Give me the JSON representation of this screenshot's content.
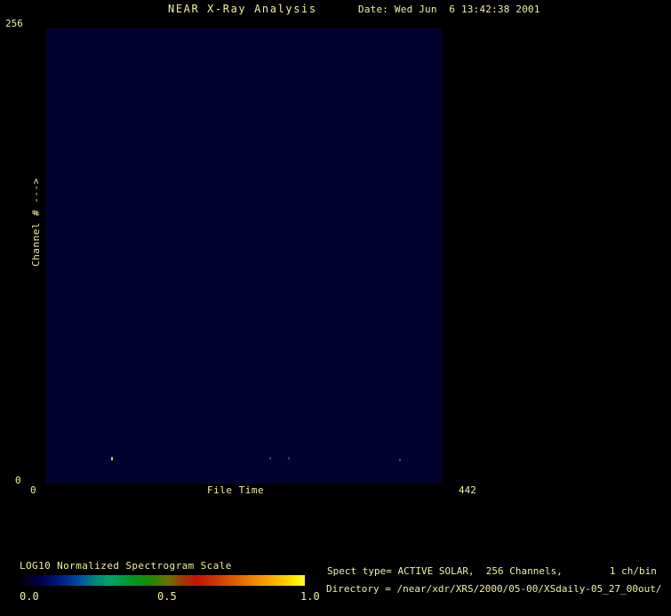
{
  "header": {
    "title": "NEAR X-Ray Analysis",
    "date_label": "Date: Wed Jun  6 13:42:38 2001"
  },
  "plot": {
    "y_axis": {
      "label": "Channel # --->",
      "max_tick": "256",
      "min_tick": "0"
    },
    "x_axis": {
      "label": "File Time",
      "min_tick": "0",
      "max_tick": "442"
    }
  },
  "colorbar": {
    "title": "LOG10 Normalized Spectrogram Scale",
    "tick_labels": [
      "0.0",
      "0.5",
      "1.0"
    ],
    "gradient_stops": [
      {
        "pos": 0,
        "color": "#000004"
      },
      {
        "pos": 7,
        "color": "#000048"
      },
      {
        "pos": 14,
        "color": "#001880"
      },
      {
        "pos": 21,
        "color": "#0050a0"
      },
      {
        "pos": 27,
        "color": "#008a80"
      },
      {
        "pos": 32,
        "color": "#00a45e"
      },
      {
        "pos": 40,
        "color": "#009420"
      },
      {
        "pos": 46,
        "color": "#1e8600"
      },
      {
        "pos": 52,
        "color": "#6d7000"
      },
      {
        "pos": 57,
        "color": "#9c3a00"
      },
      {
        "pos": 62,
        "color": "#c41400"
      },
      {
        "pos": 68,
        "color": "#cc3300"
      },
      {
        "pos": 76,
        "color": "#e06000"
      },
      {
        "pos": 84,
        "color": "#f59200"
      },
      {
        "pos": 91,
        "color": "#ffbe00"
      },
      {
        "pos": 97,
        "color": "#ffec00"
      },
      {
        "pos": 100,
        "color": "#fff83c"
      }
    ]
  },
  "footer": {
    "spect_info": "Spect type= ACTIVE SOLAR,  256 Channels,        1 ch/bin",
    "directory": "Directory = /near/xdr/XRS/2000/05-00/XSdaily-05_27_00out/"
  },
  "colors": {
    "background": "#000000",
    "text": "#f2efa3",
    "plot_background": "#02022e"
  },
  "chart_data": {
    "type": "heatmap",
    "title": "NEAR X-Ray Analysis",
    "xlabel": "File Time",
    "ylabel": "Channel #",
    "xlim": [
      0,
      442
    ],
    "ylim": [
      0,
      256
    ],
    "colorbar_label": "LOG10 Normalized Spectrogram Scale",
    "colorbar_ticks": [
      0.0,
      0.5,
      1.0
    ],
    "background_value_color": "#02022e",
    "note": "Spectrogram is almost entirely at the minimum (dark navy) level; only a few faint low-channel points are visible near the bottom of the plot.",
    "points": [
      {
        "file_time": 72,
        "channel": 14,
        "value": 0.85,
        "color": "#c9c23e",
        "px": {
          "x": 73,
          "y": 482,
          "w": 2,
          "h": 4
        }
      },
      {
        "file_time": 249,
        "channel": 14,
        "value": 0.12,
        "color": "#2b3c69",
        "px": {
          "x": 251,
          "y": 482,
          "w": 2,
          "h": 3
        }
      },
      {
        "file_time": 270,
        "channel": 14,
        "value": 0.12,
        "color": "#2b3c69",
        "px": {
          "x": 272,
          "y": 482,
          "w": 2,
          "h": 3
        }
      },
      {
        "file_time": 394,
        "channel": 13,
        "value": 0.15,
        "color": "#36466e",
        "px": {
          "x": 397,
          "y": 484,
          "w": 2,
          "h": 3
        }
      }
    ]
  }
}
